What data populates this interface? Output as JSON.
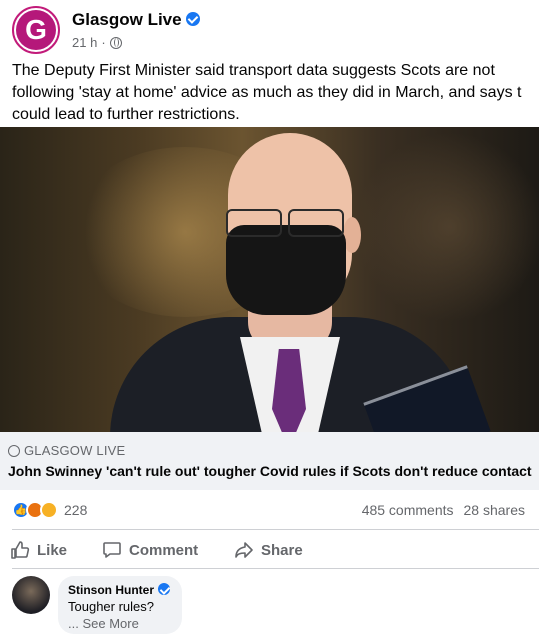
{
  "post": {
    "page_name": "Glasgow Live",
    "avatar_letter": "G",
    "time": "21 h",
    "separator": "·",
    "text_lines": [
      "The Deputy First Minister said transport data suggests Scots are not",
      "following 'stay at home' advice as much as they did in March, and says t",
      "could lead to further restrictions."
    ]
  },
  "link": {
    "source": "GLASGOW LIVE",
    "title": "John Swinney 'can't rule out' tougher Covid rules if Scots don't reduce contact"
  },
  "stats": {
    "reaction_count": "228",
    "comments": "485 comments",
    "shares": "28 shares"
  },
  "actions": {
    "like": "Like",
    "comment": "Comment",
    "share": "Share"
  },
  "comment": {
    "author": "Stinson Hunter",
    "text": "Tougher rules?",
    "see_more": "... See More"
  },
  "colors": {
    "brand": "#b5187a",
    "facebook_blue": "#1877f2",
    "secondary_text": "#65676b",
    "preview_bg": "#f0f2f5"
  },
  "icons": [
    "verified-badge-icon",
    "globe-icon",
    "like-reaction-icon",
    "angry-reaction-icon",
    "haha-reaction-icon",
    "thumbs-up-icon",
    "comment-icon",
    "share-icon"
  ]
}
